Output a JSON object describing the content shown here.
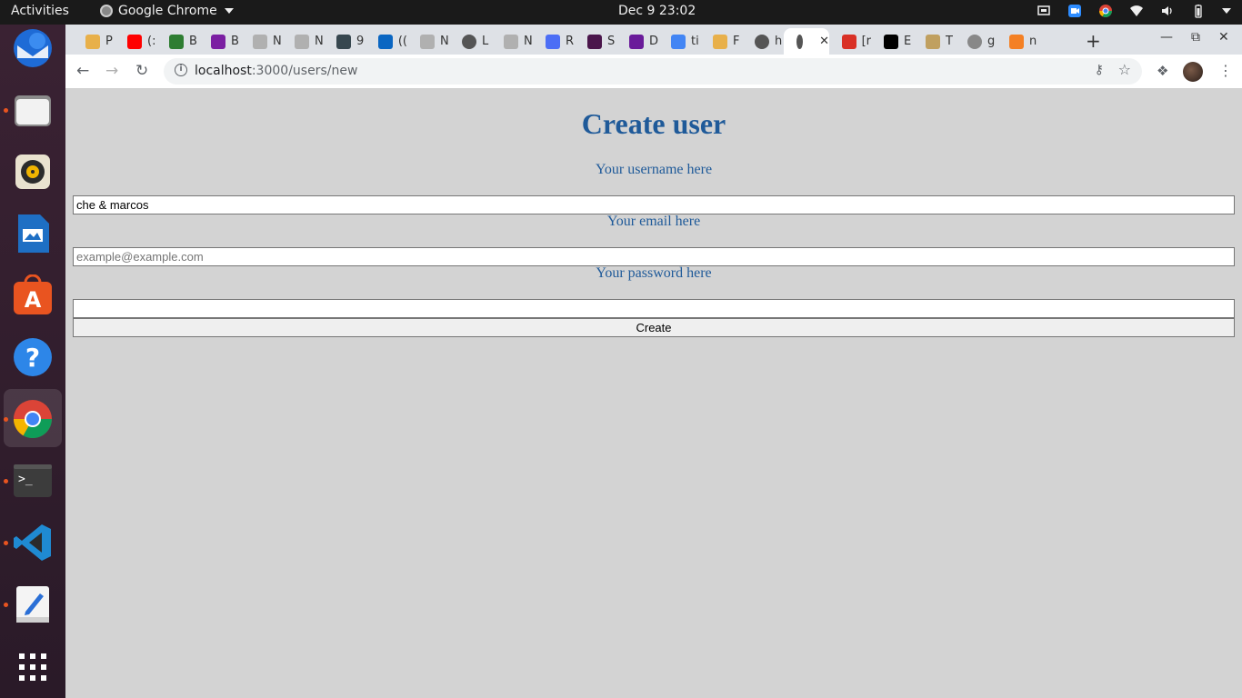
{
  "system": {
    "activities": "Activities",
    "app_name": "Google Chrome",
    "clock": "Dec 9  23:02"
  },
  "browser": {
    "tabs": [
      {
        "title": "P",
        "favicon": "bookmark-icon",
        "color": "#e8b04a"
      },
      {
        "title": "(:",
        "favicon": "youtube-icon",
        "color": "#ff0000"
      },
      {
        "title": "B",
        "favicon": "v-logo-icon",
        "color": "#2e7d32"
      },
      {
        "title": "B",
        "favicon": "twitch-like-icon",
        "color": "#7b1fa2"
      },
      {
        "title": "N",
        "favicon": "meta-icon",
        "color": "#b0b0b0"
      },
      {
        "title": "N",
        "favicon": "meta-icon",
        "color": "#b0b0b0"
      },
      {
        "title": "9",
        "favicon": "card-icon",
        "color": "#37474f"
      },
      {
        "title": "((",
        "favicon": "linkedin-icon",
        "color": "#0a66c2"
      },
      {
        "title": "N",
        "favicon": "meta-icon",
        "color": "#b0b0b0"
      },
      {
        "title": "L",
        "favicon": "globe-icon",
        "color": "#555555"
      },
      {
        "title": "N",
        "favicon": "meta-icon",
        "color": "#b0b0b0"
      },
      {
        "title": "R",
        "favicon": "docs-icon",
        "color": "#4c6ef5"
      },
      {
        "title": "S",
        "favicon": "slack-icon",
        "color": "#4a154b"
      },
      {
        "title": "D",
        "favicon": "purple-app-icon",
        "color": "#6a1b9a"
      },
      {
        "title": "ti",
        "favicon": "google-icon",
        "color": "#4285f4"
      },
      {
        "title": "F",
        "favicon": "bookmark-icon",
        "color": "#e8b04a"
      },
      {
        "title": "h",
        "favicon": "globe-icon",
        "color": "#555555"
      },
      {
        "title": "",
        "favicon": "globe-icon",
        "color": "#555555",
        "active": true
      },
      {
        "title": "[r",
        "favicon": "gmail-icon",
        "color": "#d93025"
      },
      {
        "title": "E",
        "favicon": "media-icon",
        "color": "#000000"
      },
      {
        "title": "T",
        "favicon": "chart-icon",
        "color": "#c0a060"
      },
      {
        "title": "g",
        "favicon": "globe-icon",
        "color": "#888888"
      },
      {
        "title": "n",
        "favicon": "stackoverflow-icon",
        "color": "#f48024"
      }
    ],
    "new_tab": "+",
    "url_host": "localhost",
    "url_rest": ":3000/users/new"
  },
  "form": {
    "title": "Create user",
    "username_label": "Your username here",
    "username_value": "che & marcos",
    "email_label": "Your email here",
    "email_placeholder": "example@example.com",
    "password_label": "Your password here",
    "submit_label": "Create"
  },
  "dock": [
    "thunderbird-icon",
    "files-icon",
    "rhythmbox-icon",
    "writer-icon",
    "software-icon",
    "help-icon",
    "chrome-icon",
    "terminal-icon",
    "vscode-icon",
    "text-editor-icon",
    "show-apps-icon"
  ]
}
